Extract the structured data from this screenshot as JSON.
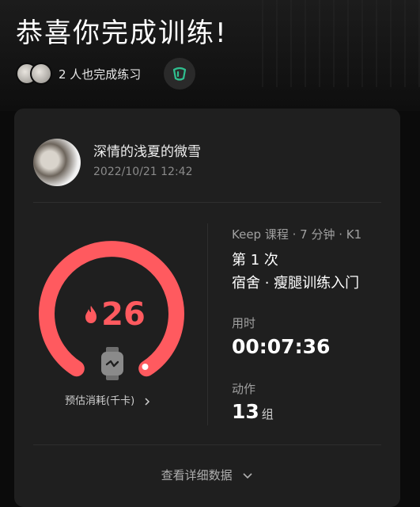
{
  "header": {
    "title": "恭喜你完成训练!",
    "peers_text": "2 人也完成练习"
  },
  "card": {
    "user": {
      "name": "深情的浅夏的微雪",
      "time": "2022/10/21 12:42"
    },
    "calories": {
      "value": "26",
      "label": "预估消耗(千卡)"
    },
    "course": {
      "meta": "Keep 课程 · 7 分钟 · K1",
      "session": "第 1 次",
      "name": "宿舍 · 瘦腿训练入门"
    },
    "duration": {
      "label": "用时",
      "value": "00:07:36"
    },
    "actions": {
      "label": "动作",
      "value": "13",
      "unit": "组"
    },
    "detail_link": "查看详细数据"
  },
  "colors": {
    "accent": "#ff5a5f",
    "like_icon": "#2fbf8f",
    "card_bg": "#1f1f1f"
  },
  "icons": [
    "flame-icon",
    "watch-icon",
    "chevron-right-icon",
    "chevron-down-icon",
    "cheer-icon"
  ]
}
